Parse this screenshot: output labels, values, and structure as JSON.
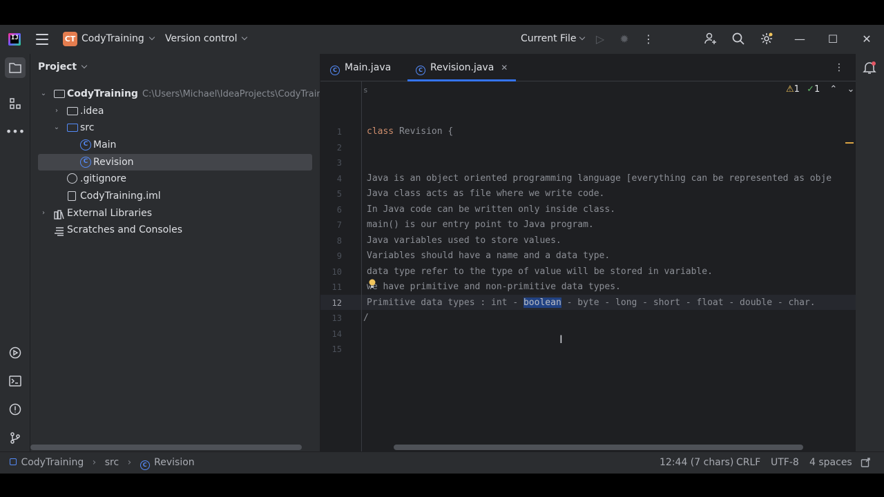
{
  "titlebar": {
    "project_initials": "CT",
    "project_name": "CodyTraining",
    "vcs_label": "Version control",
    "run_config": "Current File"
  },
  "project_panel": {
    "title": "Project",
    "root": {
      "label": "CodyTraining",
      "path": "C:\\Users\\Michael\\IdeaProjects\\CodyTrainin"
    },
    "items": [
      {
        "label": ".idea"
      },
      {
        "label": "src"
      },
      {
        "label": "Main"
      },
      {
        "label": "Revision"
      },
      {
        "label": ".gitignore"
      },
      {
        "label": "CodyTraining.iml"
      },
      {
        "label": "External Libraries"
      },
      {
        "label": "Scratches and Consoles"
      }
    ]
  },
  "editor": {
    "tabs": [
      {
        "label": "Main.java"
      },
      {
        "label": "Revision.java"
      }
    ],
    "sticky_hint": "s",
    "inspections": {
      "warnings": "1",
      "checks": "1"
    },
    "lines": [
      {
        "n": "1",
        "kw": "class",
        "text": " Revision {"
      },
      {
        "n": "2",
        "text": ""
      },
      {
        "n": "3",
        "text": ""
      },
      {
        "n": "4",
        "text": "Java is an object oriented programming language [everything can be represented as obje"
      },
      {
        "n": "5",
        "text": "Java class acts as file where we write code."
      },
      {
        "n": "6",
        "text": "In Java code can be written only inside class."
      },
      {
        "n": "7",
        "text": "main() is our entry point to Java program."
      },
      {
        "n": "8",
        "text": "Java variables used to store values."
      },
      {
        "n": "9",
        "text": "Variables should have a name and a data type."
      },
      {
        "n": "10",
        "text": "data type refer to the type of value will be stored in variable."
      },
      {
        "n": "11",
        "text": "we have primitive and non-primitive data types."
      },
      {
        "n": "12",
        "pre": "Primitive data types : int - ",
        "selected": "boolean",
        "post": " - byte - long - short - float - double - char."
      },
      {
        "n": "13",
        "text": "/"
      },
      {
        "n": "14",
        "text": ""
      },
      {
        "n": "15",
        "text": ""
      }
    ],
    "current_line": "12"
  },
  "statusbar": {
    "breadcrumb": [
      "CodyTraining",
      "src",
      "Revision"
    ],
    "position": "12:44 (7 chars)",
    "line_ending": "CRLF",
    "encoding": "UTF-8",
    "indent": "4 spaces"
  },
  "colors": {
    "accent": "#3574f0",
    "keyword": "#cf8e6d",
    "selection": "#214283",
    "badge": "#e57d4f"
  }
}
